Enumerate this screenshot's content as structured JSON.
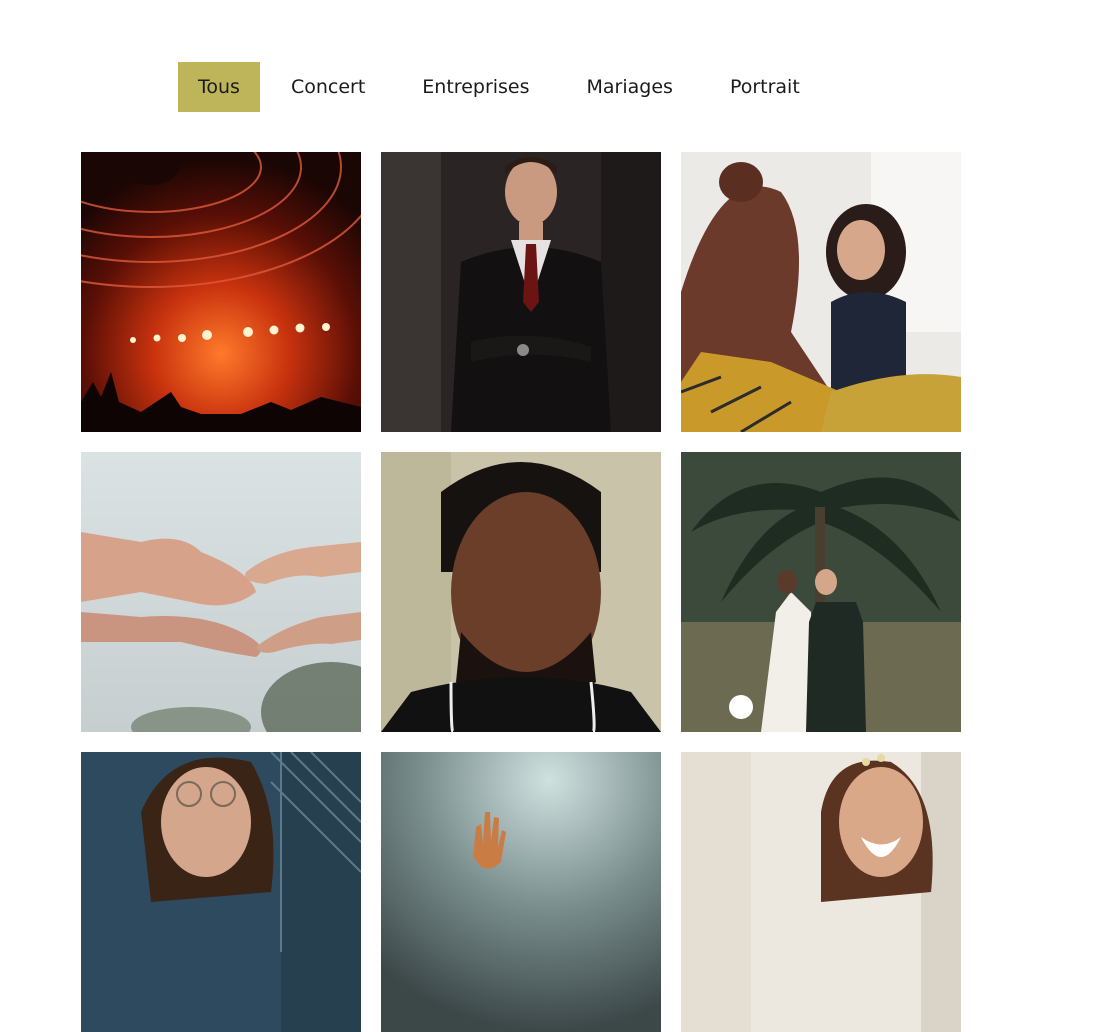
{
  "filters": [
    {
      "label": "Tous",
      "active": true
    },
    {
      "label": "Concert",
      "active": false
    },
    {
      "label": "Entreprises",
      "active": false
    },
    {
      "label": "Mariages",
      "active": false
    },
    {
      "label": "Portrait",
      "active": false
    }
  ],
  "gallery": {
    "photos": [
      {
        "subject": "concert stage with red lights and crowd"
      },
      {
        "subject": "man in dark suit with arms crossed"
      },
      {
        "subject": "smiling woman in meeting"
      },
      {
        "subject": "reaching hands against sky"
      },
      {
        "subject": "bearded man with eyes closed"
      },
      {
        "subject": "wedding couple walking under palm tree"
      },
      {
        "subject": "woman with glasses"
      },
      {
        "subject": "raised hand in smoke"
      },
      {
        "subject": "laughing bride"
      }
    ]
  },
  "colors": {
    "active_filter_bg": "#beb45a",
    "filter_text": "#1b1b1b",
    "background": "#ffffff"
  }
}
